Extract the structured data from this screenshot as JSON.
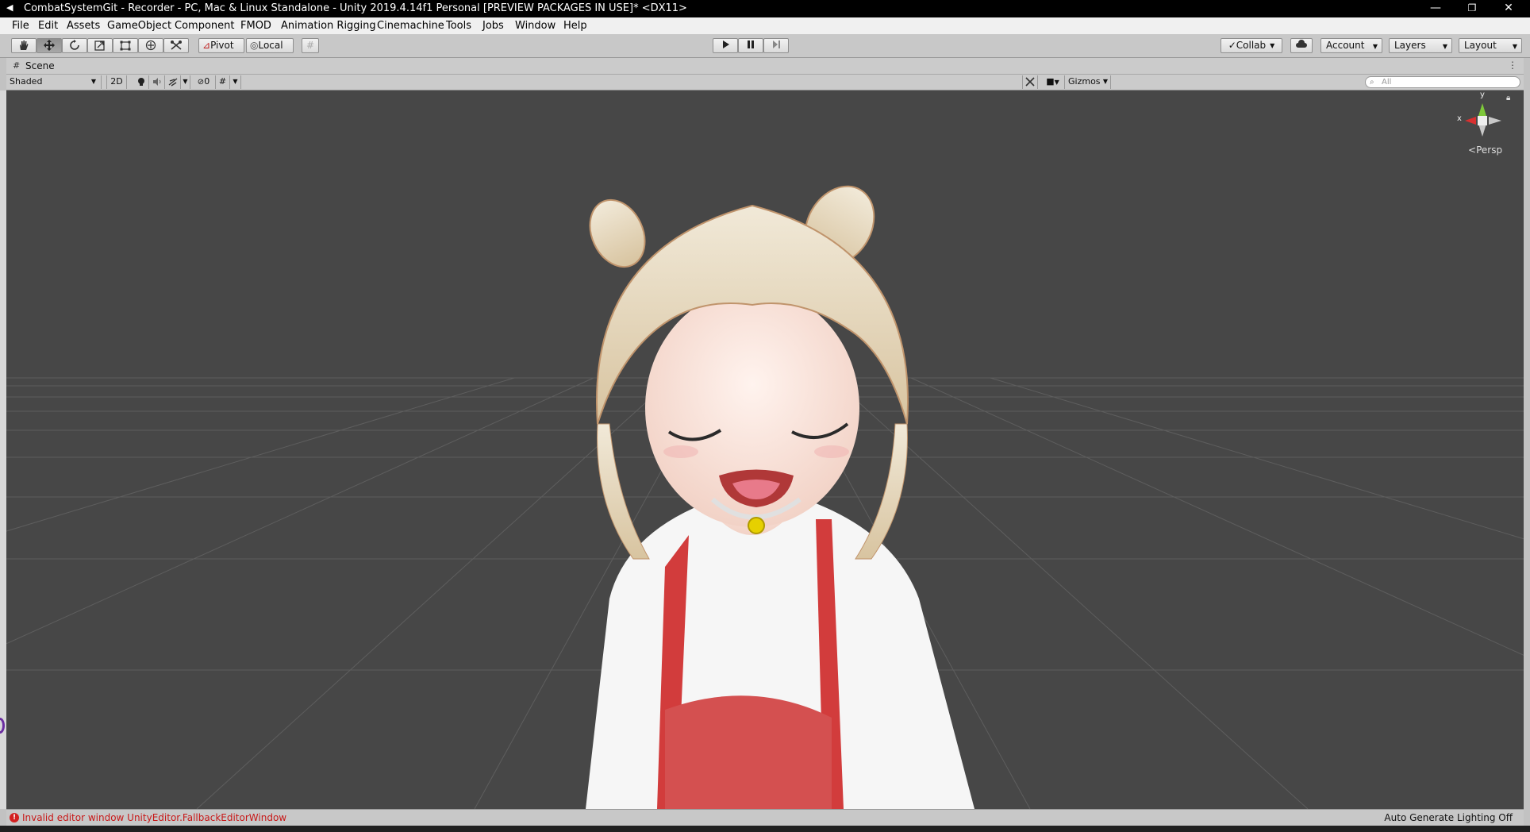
{
  "window": {
    "title": "CombatSystemGit - Recorder - PC, Mac & Linux Standalone - Unity 2019.4.14f1 Personal [PREVIEW PACKAGES IN USE]* <DX11>",
    "logo_icon": "unity-icon",
    "minimize_glyph": "—",
    "maximize_glyph": "❐",
    "close_glyph": "✕"
  },
  "menu": [
    "File",
    "Edit",
    "Assets",
    "GameObject",
    "Component",
    "FMOD",
    "Animation Rigging",
    "Cinemachine",
    "Tools",
    "Jobs",
    "Window",
    "Help"
  ],
  "toolbar": {
    "tools": [
      "hand-icon",
      "move-icon",
      "rotate-icon",
      "scale-icon",
      "rect-icon",
      "transform-icon",
      "custom-tool-icon"
    ],
    "active_tool": "move-icon",
    "pivot_label": "Pivot",
    "local_label": "Local",
    "play_icon": "play-icon",
    "pause_icon": "pause-icon",
    "step_icon": "step-icon",
    "collab_label": "Collab",
    "account_label": "Account",
    "layers_label": "Layers",
    "layout_label": "Layout"
  },
  "scene_tab": {
    "label": "Scene",
    "icon": "grid-icon"
  },
  "scene_bar": {
    "shading_mode": "Shaded",
    "two_d_label": "2D",
    "hidden_count": "0",
    "gizmos_label": "Gizmos",
    "search_placeholder": "All"
  },
  "viewport": {
    "background_color": "#474747",
    "gizmo": {
      "y_label": "y",
      "x_label": "x",
      "projection_label": "Persp"
    }
  },
  "status": {
    "error_message": "Invalid editor window UnityEditor.FallbackEditorWindow",
    "lighting_message": "Auto Generate Lighting Off",
    "error_color": "#c81818"
  }
}
